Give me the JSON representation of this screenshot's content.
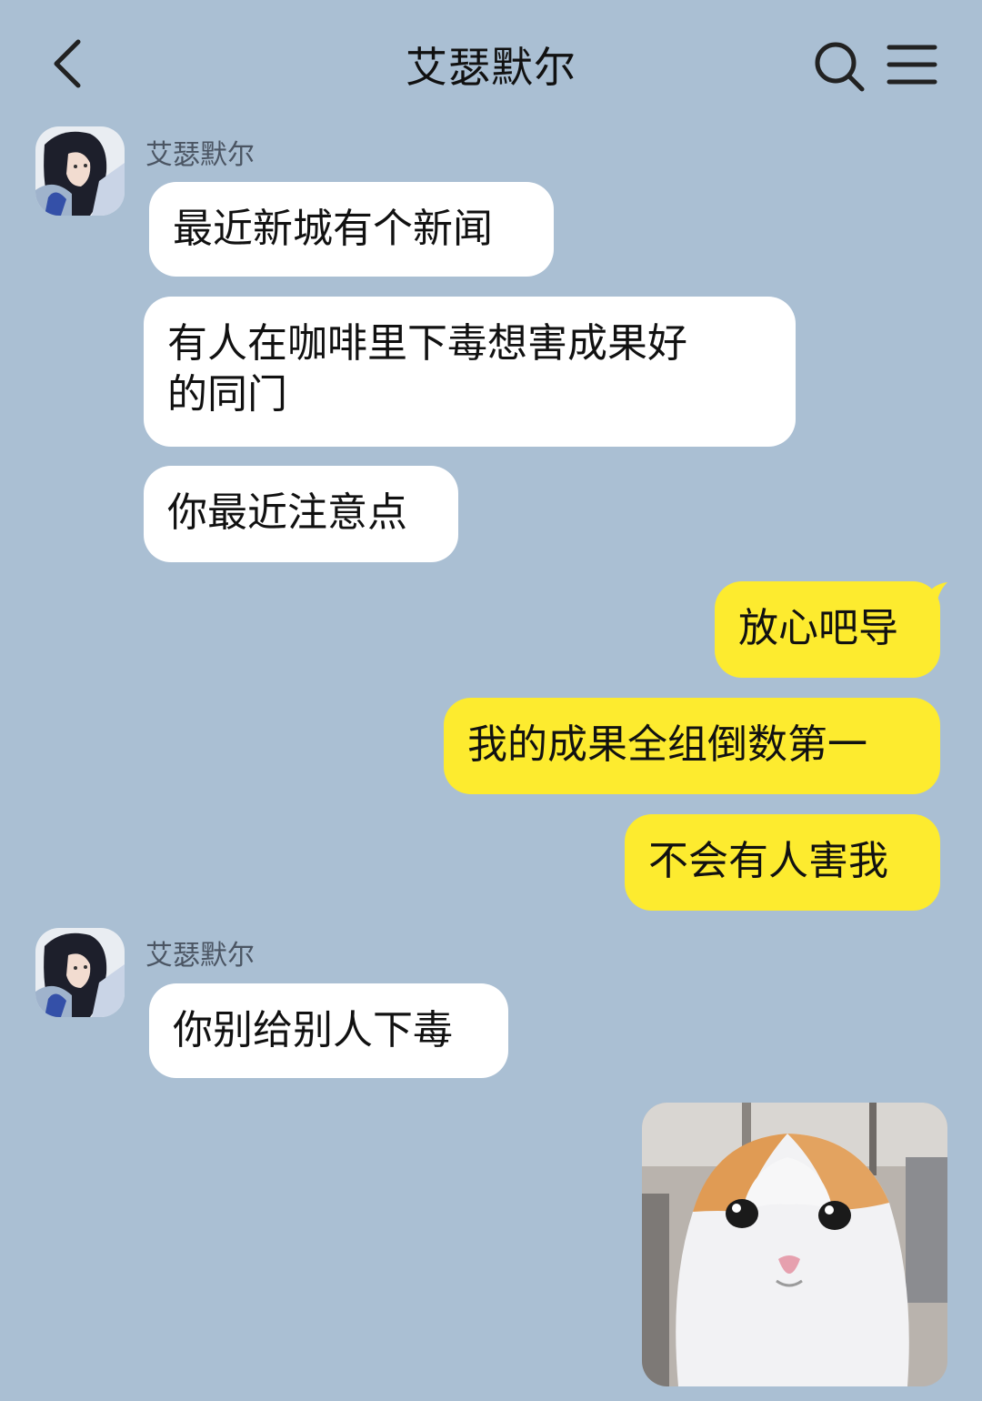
{
  "header": {
    "title": "艾瑟默尔",
    "back_icon": "chevron-left-icon",
    "search_icon": "search-icon",
    "menu_icon": "menu-icon"
  },
  "messages": [
    {
      "from": "them",
      "sender": "艾瑟默尔",
      "text": "最近新城有个新闻"
    },
    {
      "from": "them",
      "text": "有人在咖啡里下毒想害成果好\n的同门"
    },
    {
      "from": "them",
      "text": "你最近注意点"
    },
    {
      "from": "me",
      "text": "放心吧导"
    },
    {
      "from": "me",
      "text": "我的成果全组倒数第一"
    },
    {
      "from": "me",
      "text": "不会有人害我"
    },
    {
      "from": "them",
      "sender": "艾瑟默尔",
      "text": "你别给别人下毒"
    },
    {
      "from": "me",
      "type": "sticker",
      "sticker": "cat-sticker"
    }
  ],
  "colors": {
    "background": "#aabfd3",
    "incoming_bubble": "#ffffff",
    "outgoing_bubble": "#fdeb2f"
  }
}
